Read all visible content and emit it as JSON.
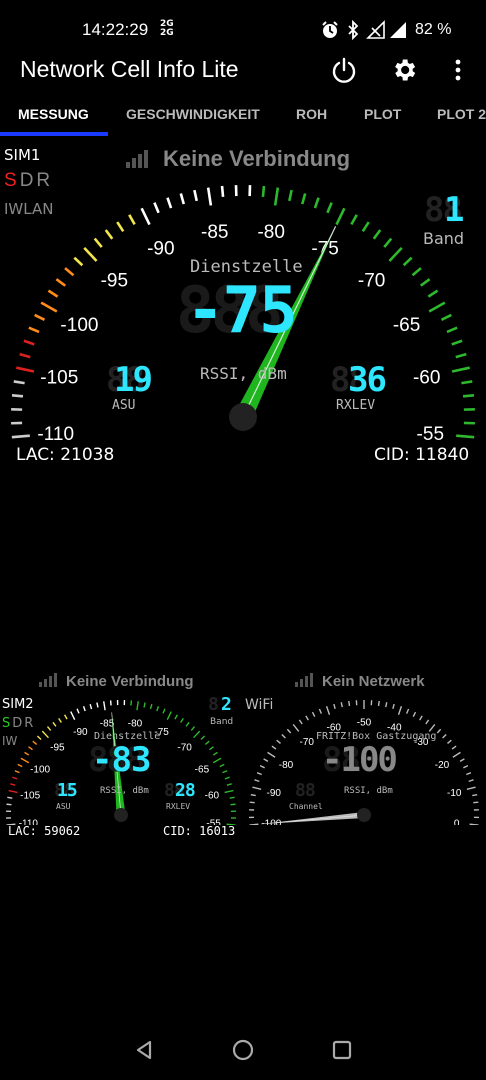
{
  "status_bar": {
    "time": "14:22:29",
    "net_top": "2G",
    "net_bottom": "2G",
    "battery": "82 %"
  },
  "app": {
    "title": "Network Cell Info Lite"
  },
  "tabs": [
    {
      "label": "MESSUNG"
    },
    {
      "label": "GESCHWINDIGKEIT"
    },
    {
      "label": "ROH"
    },
    {
      "label": "PLOT"
    },
    {
      "label": "PLOT 2"
    }
  ],
  "main_gauge": {
    "sim": "SIM1",
    "sdr_s": "S",
    "sdr_d": "D",
    "sdr_r": "R",
    "iwlan": "IWLAN",
    "status": "Keine Verbindung",
    "band_value": "1",
    "band_label": "Band",
    "cell_label": "Dienstzelle",
    "rssi_value": "-75",
    "rssi_unit": "RSSI, dBm",
    "asu_value": "19",
    "asu_label": "ASU",
    "rxlev_value": "36",
    "rxlev_label": "RXLEV",
    "lac": "LAC: 21038",
    "cid": "CID: 11840",
    "scale": [
      "-110",
      "-105",
      "-100",
      "-95",
      "-90",
      "-85",
      "-80",
      "-75",
      "-70",
      "-65",
      "-60",
      "-55"
    ],
    "needle_value": -75
  },
  "sim2_gauge": {
    "sim": "SIM2",
    "sdr_s": "S",
    "sdr_d": "D",
    "sdr_r": "R",
    "iwlan": "IW",
    "status": "Keine Verbindung",
    "band_value": "2",
    "band_label": "Band",
    "cell_label": "Dienstzelle",
    "rssi_value": "-83",
    "rssi_unit": "RSSI, dBm",
    "asu_value": "15",
    "asu_label": "ASU",
    "rxlev_value": "28",
    "rxlev_label": "RXLEV",
    "lac": "LAC: 59062",
    "cid": "CID: 16013",
    "scale": [
      "-110",
      "-105",
      "-100",
      "-95",
      "-90",
      "-85",
      "-80",
      "-75",
      "-70",
      "-65",
      "-60",
      "-55"
    ],
    "needle_value": -84
  },
  "wifi_gauge": {
    "label": "WiFi",
    "status": "Kein Netzwerk",
    "ssid": "FRITZ!Box Gastzugang",
    "rssi_value": "-100",
    "rssi_unit": "RSSI, dBm",
    "channel_label": "Channel",
    "scale": [
      "-100",
      "-90",
      "-80",
      "-70",
      "-60",
      "-50",
      "-40",
      "-30",
      "-20",
      "-10",
      "0"
    ],
    "needle_value": -100
  },
  "colors": {
    "accent_tab": "#1a3bff",
    "needle": "#1fb51f",
    "digit": "#2ee6ff",
    "sdr_active_sim1": "#e22222",
    "sdr_active_sim2": "#22cc22"
  }
}
